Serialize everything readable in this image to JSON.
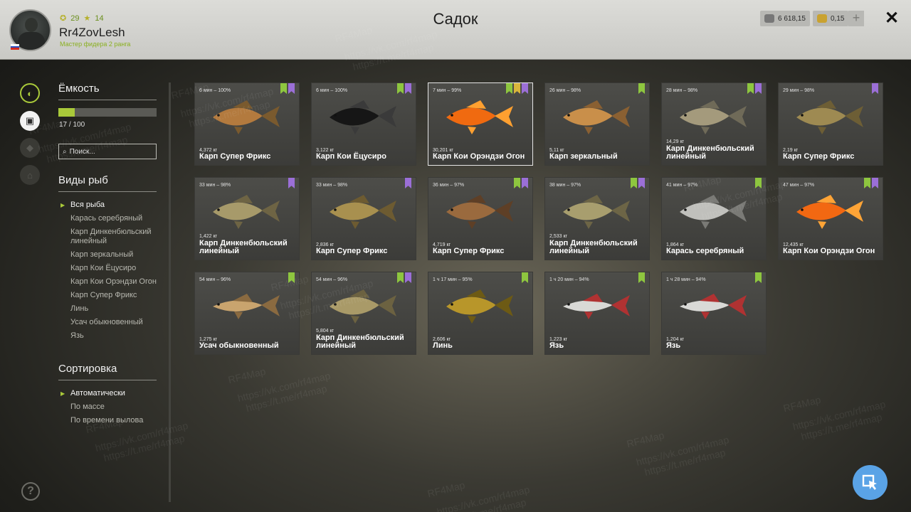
{
  "header": {
    "title": "Садок",
    "player": {
      "name": "Rr4ZovLesh",
      "rank": "Мастер фидера 2 ранга",
      "level": "29",
      "stars": "14"
    },
    "currency": {
      "silver": "6 618,15",
      "gold": "0,15"
    },
    "plus_label": "+",
    "close_label": "✕"
  },
  "capacity": {
    "title": "Ёмкость",
    "used": 17,
    "max": 100,
    "text": "17 / 100"
  },
  "search": {
    "placeholder": "Поиск..."
  },
  "species": {
    "title": "Виды рыб",
    "items": [
      "Вся рыба",
      "Карась серебряный",
      "Карп Динкенбюльский линейный",
      "Карп зеркальный",
      "Карп Кои Ёцусиро",
      "Карп Кои Орэндзи Огон",
      "Карп Супер Фрикс",
      "Линь",
      "Усач обыкновенный",
      "Язь"
    ]
  },
  "sorting": {
    "title": "Сортировка",
    "items": [
      "Автоматически",
      "По массе",
      "По времени вылова"
    ]
  },
  "help_label": "?",
  "fish": [
    {
      "time": "6 мин – 100%",
      "weight": "4,372 кг",
      "name": "Карп Супер Фрикс",
      "badges": [
        "green",
        "purple"
      ],
      "colors": [
        "#b37a3e",
        "#7a5a2e"
      ],
      "selected": false
    },
    {
      "time": "6 мин – 100%",
      "weight": "3,122 кг",
      "name": "Карп Кои Ёцусиро",
      "badges": [
        "green",
        "purple"
      ],
      "colors": [
        "#161616",
        "#3a3a3a"
      ],
      "selected": false
    },
    {
      "time": "7 мин – 99%",
      "weight": "30,201 кг",
      "name": "Карп Кои Орэндзи Огон",
      "badges": [
        "green",
        "gold",
        "purple"
      ],
      "colors": [
        "#f06a10",
        "#ffa030"
      ],
      "selected": true
    },
    {
      "time": "26 мин – 98%",
      "weight": "5,11 кг",
      "name": "Карп зеркальный",
      "badges": [
        "green"
      ],
      "colors": [
        "#c98f4a",
        "#8a6032"
      ],
      "selected": false
    },
    {
      "time": "28 мин – 98%",
      "weight": "14,29 кг",
      "name": "Карп Динкенбюльский линейный",
      "badges": [
        "green",
        "purple"
      ],
      "colors": [
        "#a49a7c",
        "#6f6a58"
      ],
      "selected": false
    },
    {
      "time": "29 мин – 98%",
      "weight": "2,19 кг",
      "name": "Карп Супер Фрикс",
      "badges": [
        "purple"
      ],
      "colors": [
        "#9e8a52",
        "#6d5e35"
      ],
      "selected": false
    },
    {
      "time": "33 мин – 98%",
      "weight": "1,422 кг",
      "name": "Карп Динкенбюльский линейный",
      "badges": [
        "purple"
      ],
      "colors": [
        "#a79a6a",
        "#6e6444"
      ],
      "selected": false
    },
    {
      "time": "33 мин – 98%",
      "weight": "2,836 кг",
      "name": "Карп Супер Фрикс",
      "badges": [
        "purple"
      ],
      "colors": [
        "#a8904f",
        "#6d5b31"
      ],
      "selected": false
    },
    {
      "time": "36 мин – 97%",
      "weight": "4,719 кг",
      "name": "Карп Супер Фрикс",
      "badges": [
        "green",
        "purple"
      ],
      "colors": [
        "#9a6a3e",
        "#5e3f26"
      ],
      "selected": false
    },
    {
      "time": "38 мин – 97%",
      "weight": "2,533 кг",
      "name": "Карп Динкенбюльский линейный",
      "badges": [
        "green",
        "purple"
      ],
      "colors": [
        "#a89e6e",
        "#6d6546"
      ],
      "selected": false
    },
    {
      "time": "41 мин – 97%",
      "weight": "1,864 кг",
      "name": "Карась серебряный",
      "badges": [
        "green"
      ],
      "colors": [
        "#c0c0bc",
        "#7a7a76"
      ],
      "selected": false
    },
    {
      "time": "47 мин – 97%",
      "weight": "12,435 кг",
      "name": "Карп Кои Орэндзи Огон",
      "badges": [
        "green",
        "purple"
      ],
      "colors": [
        "#f26812",
        "#ffa436"
      ],
      "selected": false
    },
    {
      "time": "54 мин – 96%",
      "weight": "1,275 кг",
      "name": "Усач обыкновенный",
      "badges": [
        "green"
      ],
      "colors": [
        "#c9a46e",
        "#8a6a40"
      ],
      "selected": false
    },
    {
      "time": "54 мин – 96%",
      "weight": "5,804 кг",
      "name": "Карп Динкенбюльский линейный",
      "badges": [
        "green",
        "purple"
      ],
      "colors": [
        "#a99a68",
        "#6c6241"
      ],
      "selected": false
    },
    {
      "time": "1 ч 17 мин – 95%",
      "weight": "2,606 кг",
      "name": "Линь",
      "badges": [
        "green"
      ],
      "colors": [
        "#b8962a",
        "#6d5a14"
      ],
      "selected": false
    },
    {
      "time": "1 ч 20 мин – 94%",
      "weight": "1,223 кг",
      "name": "Язь",
      "badges": [
        "green"
      ],
      "colors": [
        "#d9d9d6",
        "#b03232"
      ],
      "selected": false
    },
    {
      "time": "1 ч 28 мин – 94%",
      "weight": "1,204 кг",
      "name": "Язь",
      "badges": [
        "green"
      ],
      "colors": [
        "#d9d9d6",
        "#b03232"
      ],
      "selected": false
    }
  ],
  "watermark": {
    "lines": [
      "RF4Map",
      "https://vk.com/rf4map",
      "https://t.me/rf4map"
    ]
  }
}
